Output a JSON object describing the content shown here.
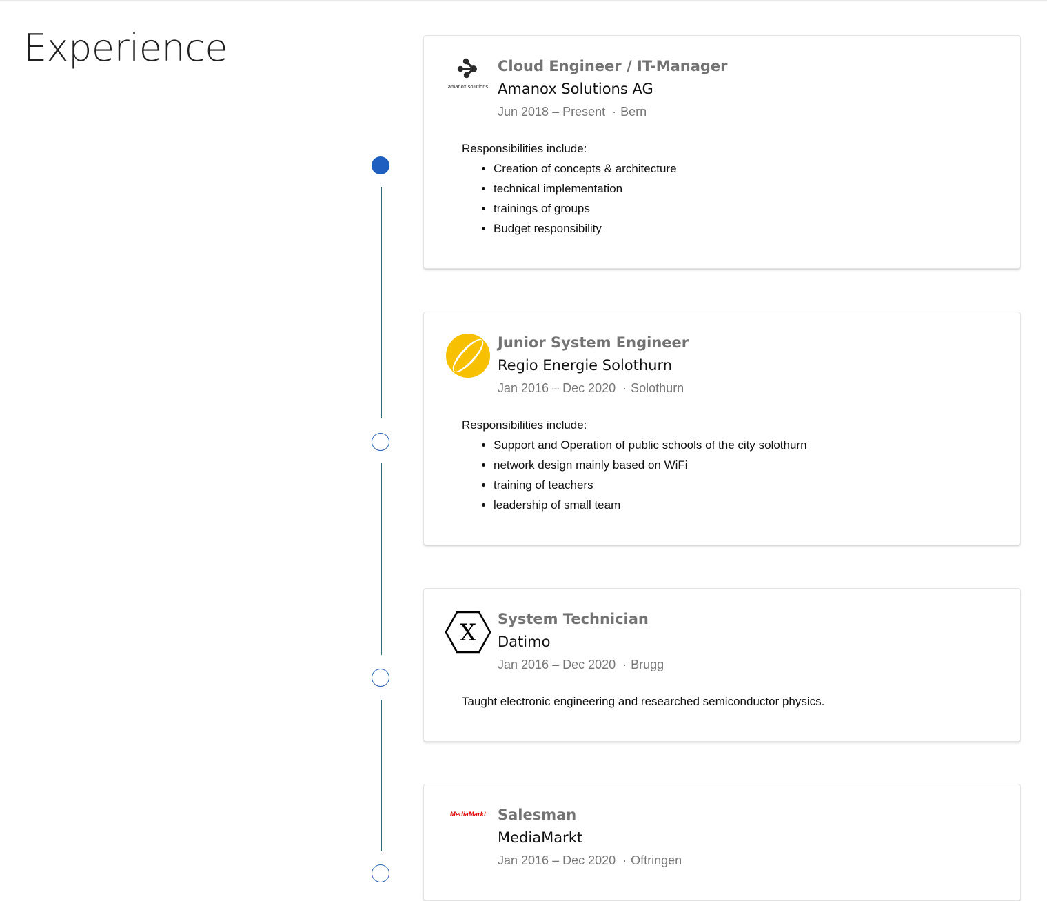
{
  "section": {
    "title": "Experience"
  },
  "experience": [
    {
      "title": "Cloud Engineer / IT-Manager",
      "company": "Amanox Solutions AG",
      "period": "Jun 2018 – Present",
      "location": "Bern",
      "logo": {
        "icon": "amanox-logo",
        "caption": "amanox solutions",
        "color": "#2b2b2b"
      },
      "intro": "Responsibilities include:",
      "bullets": [
        "Creation of concepts & architecture",
        "technical implementation",
        "trainings of groups",
        "Budget responsibility"
      ],
      "active": true
    },
    {
      "title": "Junior System Engineer",
      "company": "Regio Energie Solothurn",
      "period": "Jan 2016 – Dec 2020",
      "location": "Solothurn",
      "logo": {
        "icon": "regio-energie-logo",
        "color": "#f7c000"
      },
      "intro": "Responsibilities include:",
      "bullets": [
        "Support and Operation of public schools of the city solothurn",
        "network design mainly based on WiFi",
        "training of teachers",
        "leadership of small team"
      ],
      "active": false
    },
    {
      "title": "System Technician",
      "company": "Datimo",
      "period": "Jan 2016 – Dec 2020",
      "location": "Brugg",
      "logo": {
        "icon": "datimo-hexagon-x-logo",
        "glyph": "X",
        "color": "#000000"
      },
      "text": "Taught electronic engineering and researched semiconductor physics.",
      "active": false
    },
    {
      "title": "Salesman",
      "company": "MediaMarkt",
      "period": "Jan 2016 – Dec 2020",
      "location": "Oftringen",
      "logo": {
        "icon": "mediamarkt-logo",
        "wordmark": "MediaMarkt",
        "color": "#df0000"
      },
      "active": false
    }
  ],
  "colors": {
    "timeline_line": "#2e6b76",
    "timeline_dot": "#2b64b5",
    "timeline_dot_active": "#1e5fbf",
    "title_gray": "#737373"
  }
}
